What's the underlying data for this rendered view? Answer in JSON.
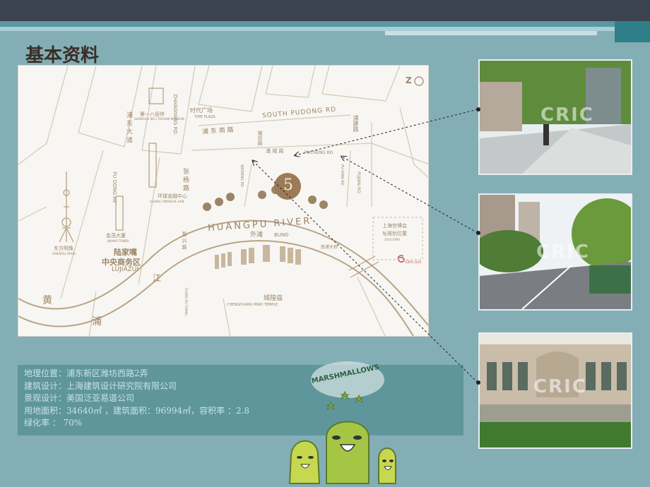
{
  "title": "基本资料",
  "info": {
    "lines": [
      "地理位置：浦东新区潍坊西路2弄",
      "建筑设计：上海建筑设计研究院有限公司",
      "景观设计：美国泛亚易道公司",
      "用地面积：34640㎡ ，建筑面积：96994㎡，容积率 ：2.8",
      "绿化率 ： 70%"
    ]
  },
  "map": {
    "compass": "Z",
    "site_number": "5",
    "labels": {
      "pudong_south_cn": "浦 东 南 路",
      "pudong_south_en": "SOUTH PUDONG RD",
      "time_plaza_cn": "时代广场",
      "time_plaza_en": "TIME PLAZA",
      "weifang_cn": "潍坊路",
      "weifang_en": "WEIFANG RD",
      "pucheng_cn": "浦 城 路",
      "pucheng_en": "PUCHENG RD",
      "pujian_cn": "浦建路",
      "pujian_en": "PUJIAN RD",
      "pudian_en": "PU DIAN RD",
      "zhangyang_cn": "张 杨 路",
      "zhangyang_en": "ZHANGYANG RD.",
      "pudong_ave_cn": "浦 东 大 道",
      "pudong_ave_en": "PU DONG AV",
      "yaohan_cn": "第一八佰伴",
      "yaohan_en": "SHANGHAI NO.1 YAOHAN MANSION",
      "swfc_cn": "环球金融中心",
      "swfc_en": "GLOBAL FINANCIAL HUB",
      "jinmao_cn": "金茂大厦",
      "jinmao_en": "JINMAO TOWER",
      "pearl_cn": "东方明珠",
      "pearl_en": "ORIENTAL PEARL",
      "lujiazui_cn1": "陆家嘴",
      "lujiazui_cn2": "中央商务区",
      "lujiazui_en": "LUJIAZUI",
      "river_en": "HUANGPU   RIVER",
      "bund_cn": "外滩",
      "bund_en": "BUND",
      "chenghuang_cn": "城隍庙",
      "chenghuang_en": "CHENGHUANG MIAO TEMPLE",
      "expo_cn1": "上海世博会",
      "expo_cn2": "址规划位置",
      "expo_en": "2010 EXPO",
      "expo_logo": "EXPO 2010",
      "bridge_cn": "南浦大桥",
      "fuxing_cn": "复 兴 路",
      "fuxing_en": "FUXING RD TUNNEL",
      "huang_cn": "黄",
      "pu_cn": "浦",
      "jiang_cn": "江"
    }
  },
  "photos": [
    {
      "watermark": "CRIC",
      "desc_icon": "street-photo"
    },
    {
      "watermark": "CRIC",
      "desc_icon": "road-photo"
    },
    {
      "watermark": "CRIC",
      "desc_icon": "building-photo"
    }
  ],
  "mascot": {
    "text": "MARSHMALLOWS"
  },
  "colors": {
    "background": "#84aeb5",
    "top_bar": "#3c4350",
    "info_box": "#5e969c",
    "map_ink": "#b9a384"
  }
}
